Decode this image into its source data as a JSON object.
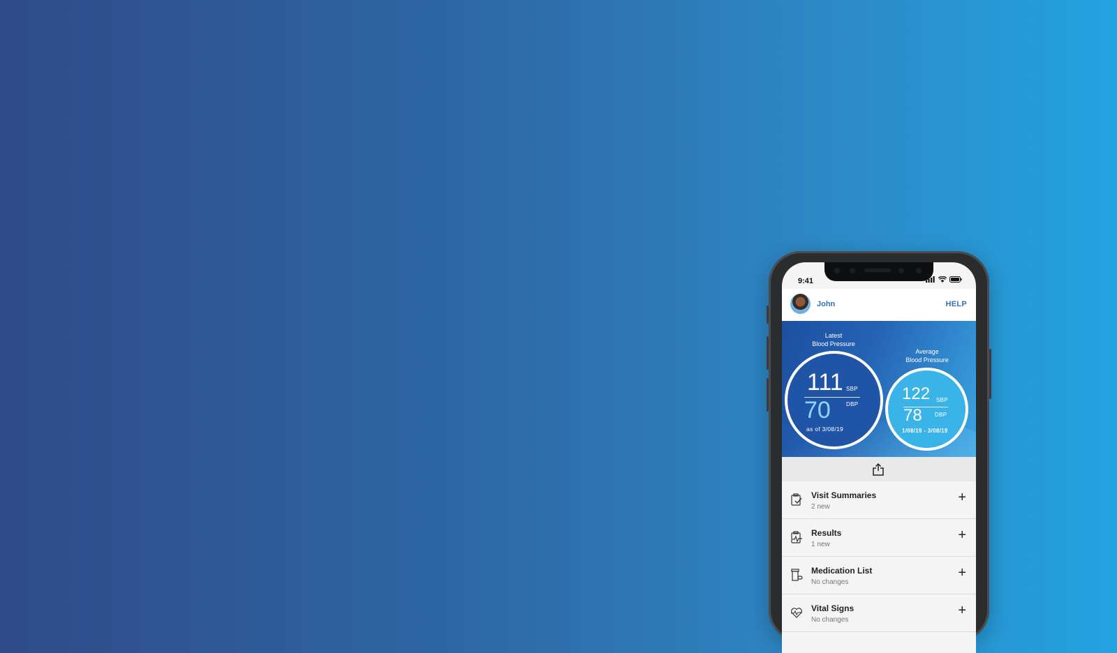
{
  "status_bar": {
    "time": "9:41"
  },
  "header": {
    "user_name": "John",
    "help_label": "HELP"
  },
  "latest_bp": {
    "caption_line1": "Latest",
    "caption_line2": "Blood Pressure",
    "sbp": "111",
    "dbp": "70",
    "sbp_label": "SBP",
    "dbp_label": "DBP",
    "date": "as of 3/08/19"
  },
  "average_bp": {
    "caption_line1": "Average",
    "caption_line2": "Blood Pressure",
    "sbp": "122",
    "dbp": "78",
    "sbp_label": "SBP",
    "dbp_label": "DBP",
    "range": "1/08/19 - 3/08/19"
  },
  "list": [
    {
      "title": "Visit Summaries",
      "sub": "2 new",
      "icon": "clipboard-check-icon"
    },
    {
      "title": "Results",
      "sub": "1 new",
      "icon": "clipboard-pulse-icon"
    },
    {
      "title": "Medication List",
      "sub": "No changes",
      "icon": "pill-bottle-icon"
    },
    {
      "title": "Vital Signs",
      "sub": "No changes",
      "icon": "heart-pulse-icon"
    }
  ],
  "colors": {
    "accent": "#2e72b8",
    "bp_ring_latest": "#1f54a6",
    "bp_ring_average": "#3ab3e8"
  }
}
